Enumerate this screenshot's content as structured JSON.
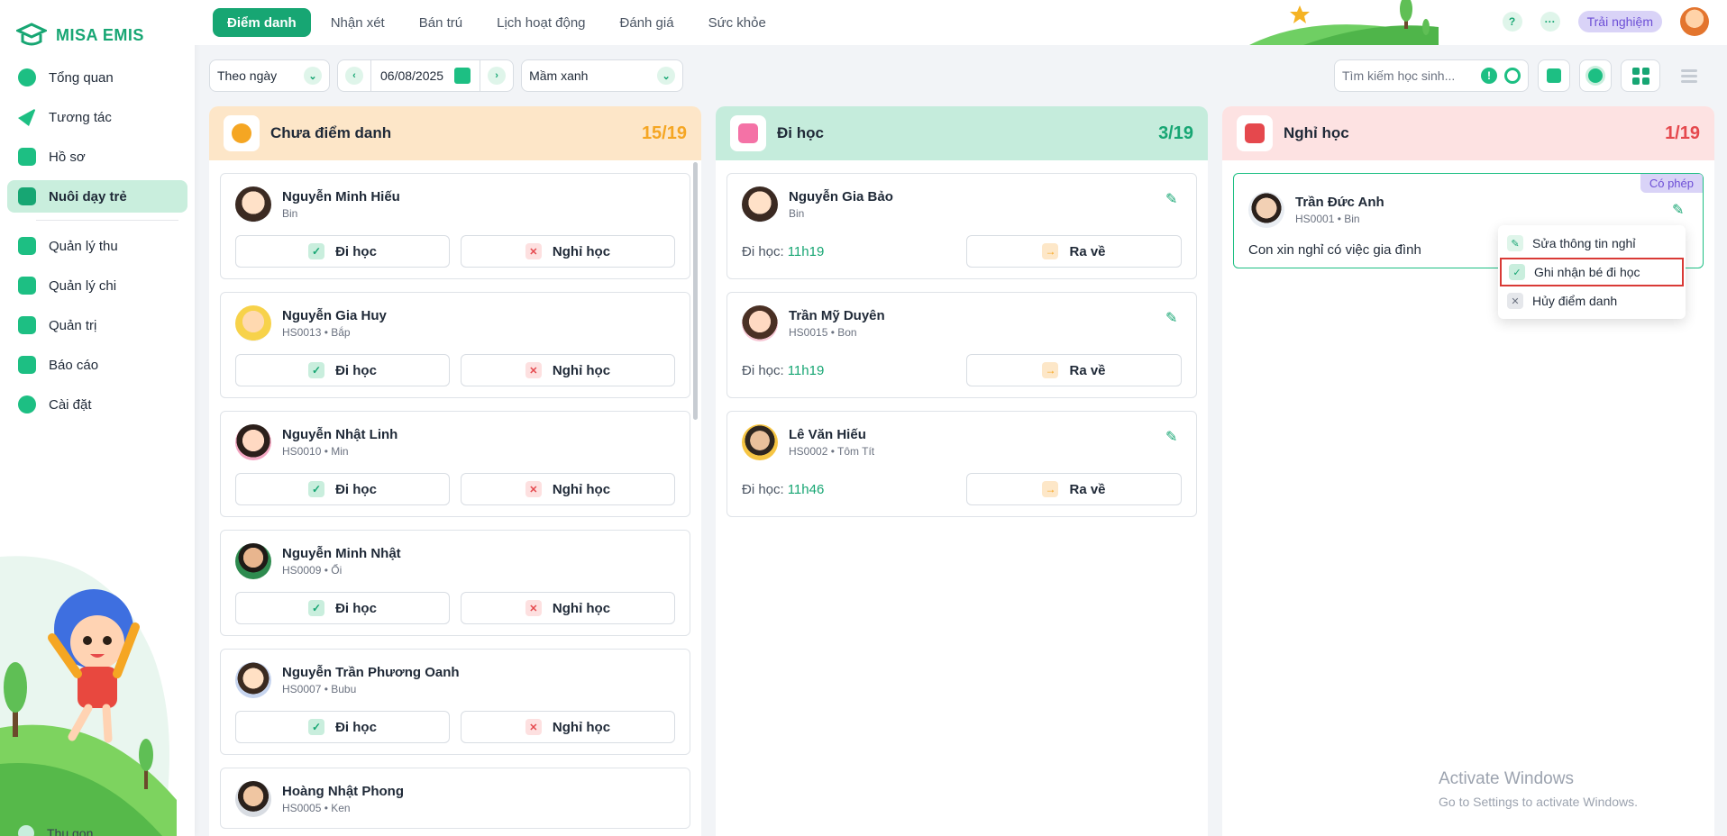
{
  "brand": {
    "name": "MISA EMIS"
  },
  "sidebar": {
    "items": [
      {
        "label": "Tổng quan",
        "icon": "pie-chart-icon"
      },
      {
        "label": "Tương tác",
        "icon": "paper-plane-icon"
      },
      {
        "label": "Hồ sơ",
        "icon": "folder-icon"
      },
      {
        "label": "Nuôi dạy trẻ",
        "icon": "home-heart-icon",
        "active": true
      },
      {
        "label": "Quản lý thu",
        "icon": "chart-up-icon"
      },
      {
        "label": "Quản lý chi",
        "icon": "wallet-icon"
      },
      {
        "label": "Quản trị",
        "icon": "briefcase-icon"
      },
      {
        "label": "Báo cáo",
        "icon": "bar-chart-icon"
      },
      {
        "label": "Cài đặt",
        "icon": "settings-icon"
      }
    ],
    "collapse_label": "Thu gọn"
  },
  "topbar": {
    "tabs": [
      "Điểm danh",
      "Nhận xét",
      "Bán trú",
      "Lịch hoạt động",
      "Đánh giá",
      "Sức khỏe"
    ],
    "active_tab": 0,
    "help": "?",
    "more": "···",
    "trial_label": "Trải nghiệm"
  },
  "filters": {
    "mode": "Theo ngày",
    "date": "06/08/2025",
    "class_name": "Mầm xanh",
    "search_placeholder": "Tìm kiếm học sinh..."
  },
  "columns": {
    "absent_unmarked": {
      "title": "Chưa điểm danh",
      "count": "15/19",
      "present_label": "Đi học",
      "absent_label": "Nghỉ học",
      "students": [
        {
          "name": "Nguyễn Minh Hiếu",
          "sub": "Bin"
        },
        {
          "name": "Nguyễn Gia Huy",
          "sub": "HS0013 • Bắp"
        },
        {
          "name": "Nguyễn Nhật Linh",
          "sub": "HS0010 • Min"
        },
        {
          "name": "Nguyễn Minh Nhật",
          "sub": "HS0009 • Ổi"
        },
        {
          "name": "Nguyễn Trần Phương Oanh",
          "sub": "HS0007 • Bubu"
        },
        {
          "name": "Hoàng Nhật Phong",
          "sub": "HS0005 • Ken"
        }
      ]
    },
    "present": {
      "title": "Đi học",
      "count": "3/19",
      "time_label": "Đi học:",
      "checkout_label": "Ra về",
      "students": [
        {
          "name": "Nguyễn Gia Bảo",
          "sub": "Bin",
          "time": "11h19"
        },
        {
          "name": "Trần Mỹ Duyên",
          "sub": "HS0015 • Bon",
          "time": "11h19"
        },
        {
          "name": "Lê Văn Hiếu",
          "sub": "HS0002 • Tôm Tít",
          "time": "11h46"
        }
      ]
    },
    "absent": {
      "title": "Nghỉ học",
      "count": "1/19",
      "student": {
        "name": "Trần Đức Anh",
        "sub": "HS0001 • Bin",
        "badge": "Có phép",
        "note": "Con xin nghỉ có việc gia đình"
      }
    }
  },
  "context_menu": {
    "items": [
      "Sửa thông tin nghỉ",
      "Ghi nhận bé đi học",
      "Hủy điểm danh"
    ],
    "highlighted": 1
  },
  "watermark": {
    "line1": "Activate Windows",
    "line2": "Go to Settings to activate Windows."
  },
  "colors": {
    "brand": "#17a673",
    "todo": "#fde6c8",
    "present": "#c5ecdc",
    "absent": "#fde2e2",
    "todo_count": "#f5a623",
    "present_count": "#17a673",
    "absent_count": "#e5484d"
  }
}
